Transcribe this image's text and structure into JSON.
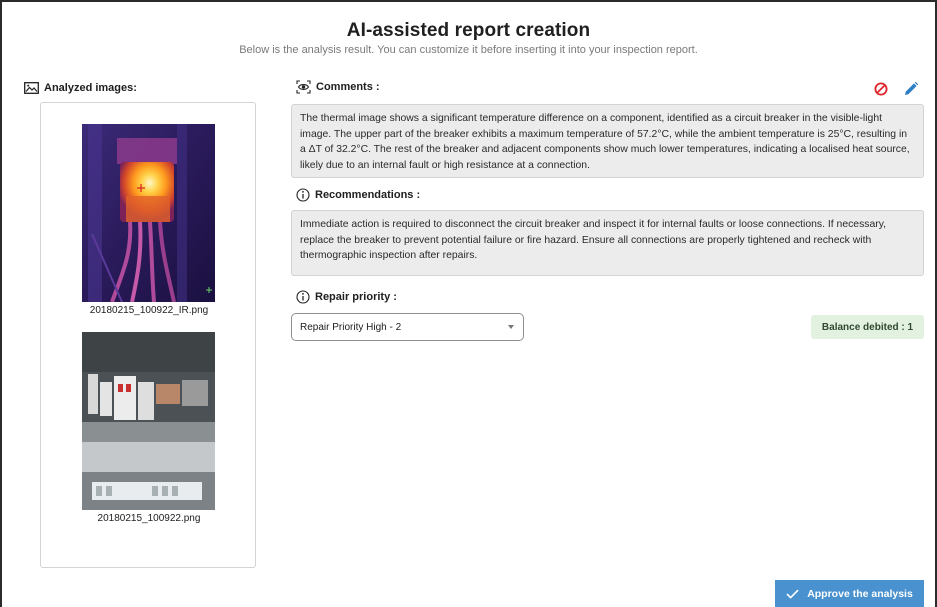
{
  "header": {
    "title": "AI-assisted report creation",
    "subtitle": "Below is the analysis result. You can customize it before inserting it into your inspection report."
  },
  "images_section": {
    "label": "Analyzed images:",
    "icon": "image-icon",
    "images": [
      {
        "caption": "20180215_100922_IR.png",
        "kind": "thermal"
      },
      {
        "caption": "20180215_100922.png",
        "kind": "visible"
      }
    ]
  },
  "comments": {
    "label": "Comments :",
    "icon": "eye-scan-icon",
    "text": "The thermal image shows a significant temperature difference on a component, identified as a circuit breaker in the visible-light image. The upper part of the breaker exhibits a maximum temperature of 57.2°C, while the ambient temperature is 25°C, resulting in a ΔT of 32.2°C. The rest of the breaker and adjacent components show much lower temperatures, indicating a localised heat source, likely due to an internal fault or high resistance at a connection.",
    "actions": {
      "discard_icon": "block-icon",
      "edit_icon": "pencil-icon"
    }
  },
  "recommendations": {
    "label": "Recommendations :",
    "icon": "info-icon",
    "text": "Immediate action is required to disconnect the circuit breaker and inspect it for internal faults or loose connections. If necessary, replace the breaker to prevent potential failure or fire hazard. Ensure all connections are properly tightened and recheck with thermographic inspection after repairs."
  },
  "repair_priority": {
    "label": "Repair priority :",
    "icon": "info-icon",
    "selected": "Repair Priority High - 2"
  },
  "balance": {
    "label": "Balance debited : 1"
  },
  "approve_button": {
    "label": "Approve the analysis",
    "icon": "check-icon"
  },
  "colors": {
    "accent": "#4a92cf",
    "danger": "#e0262b",
    "edit": "#2d7fc4",
    "success_bg": "#e3f1e1",
    "box_bg": "#ececec"
  }
}
